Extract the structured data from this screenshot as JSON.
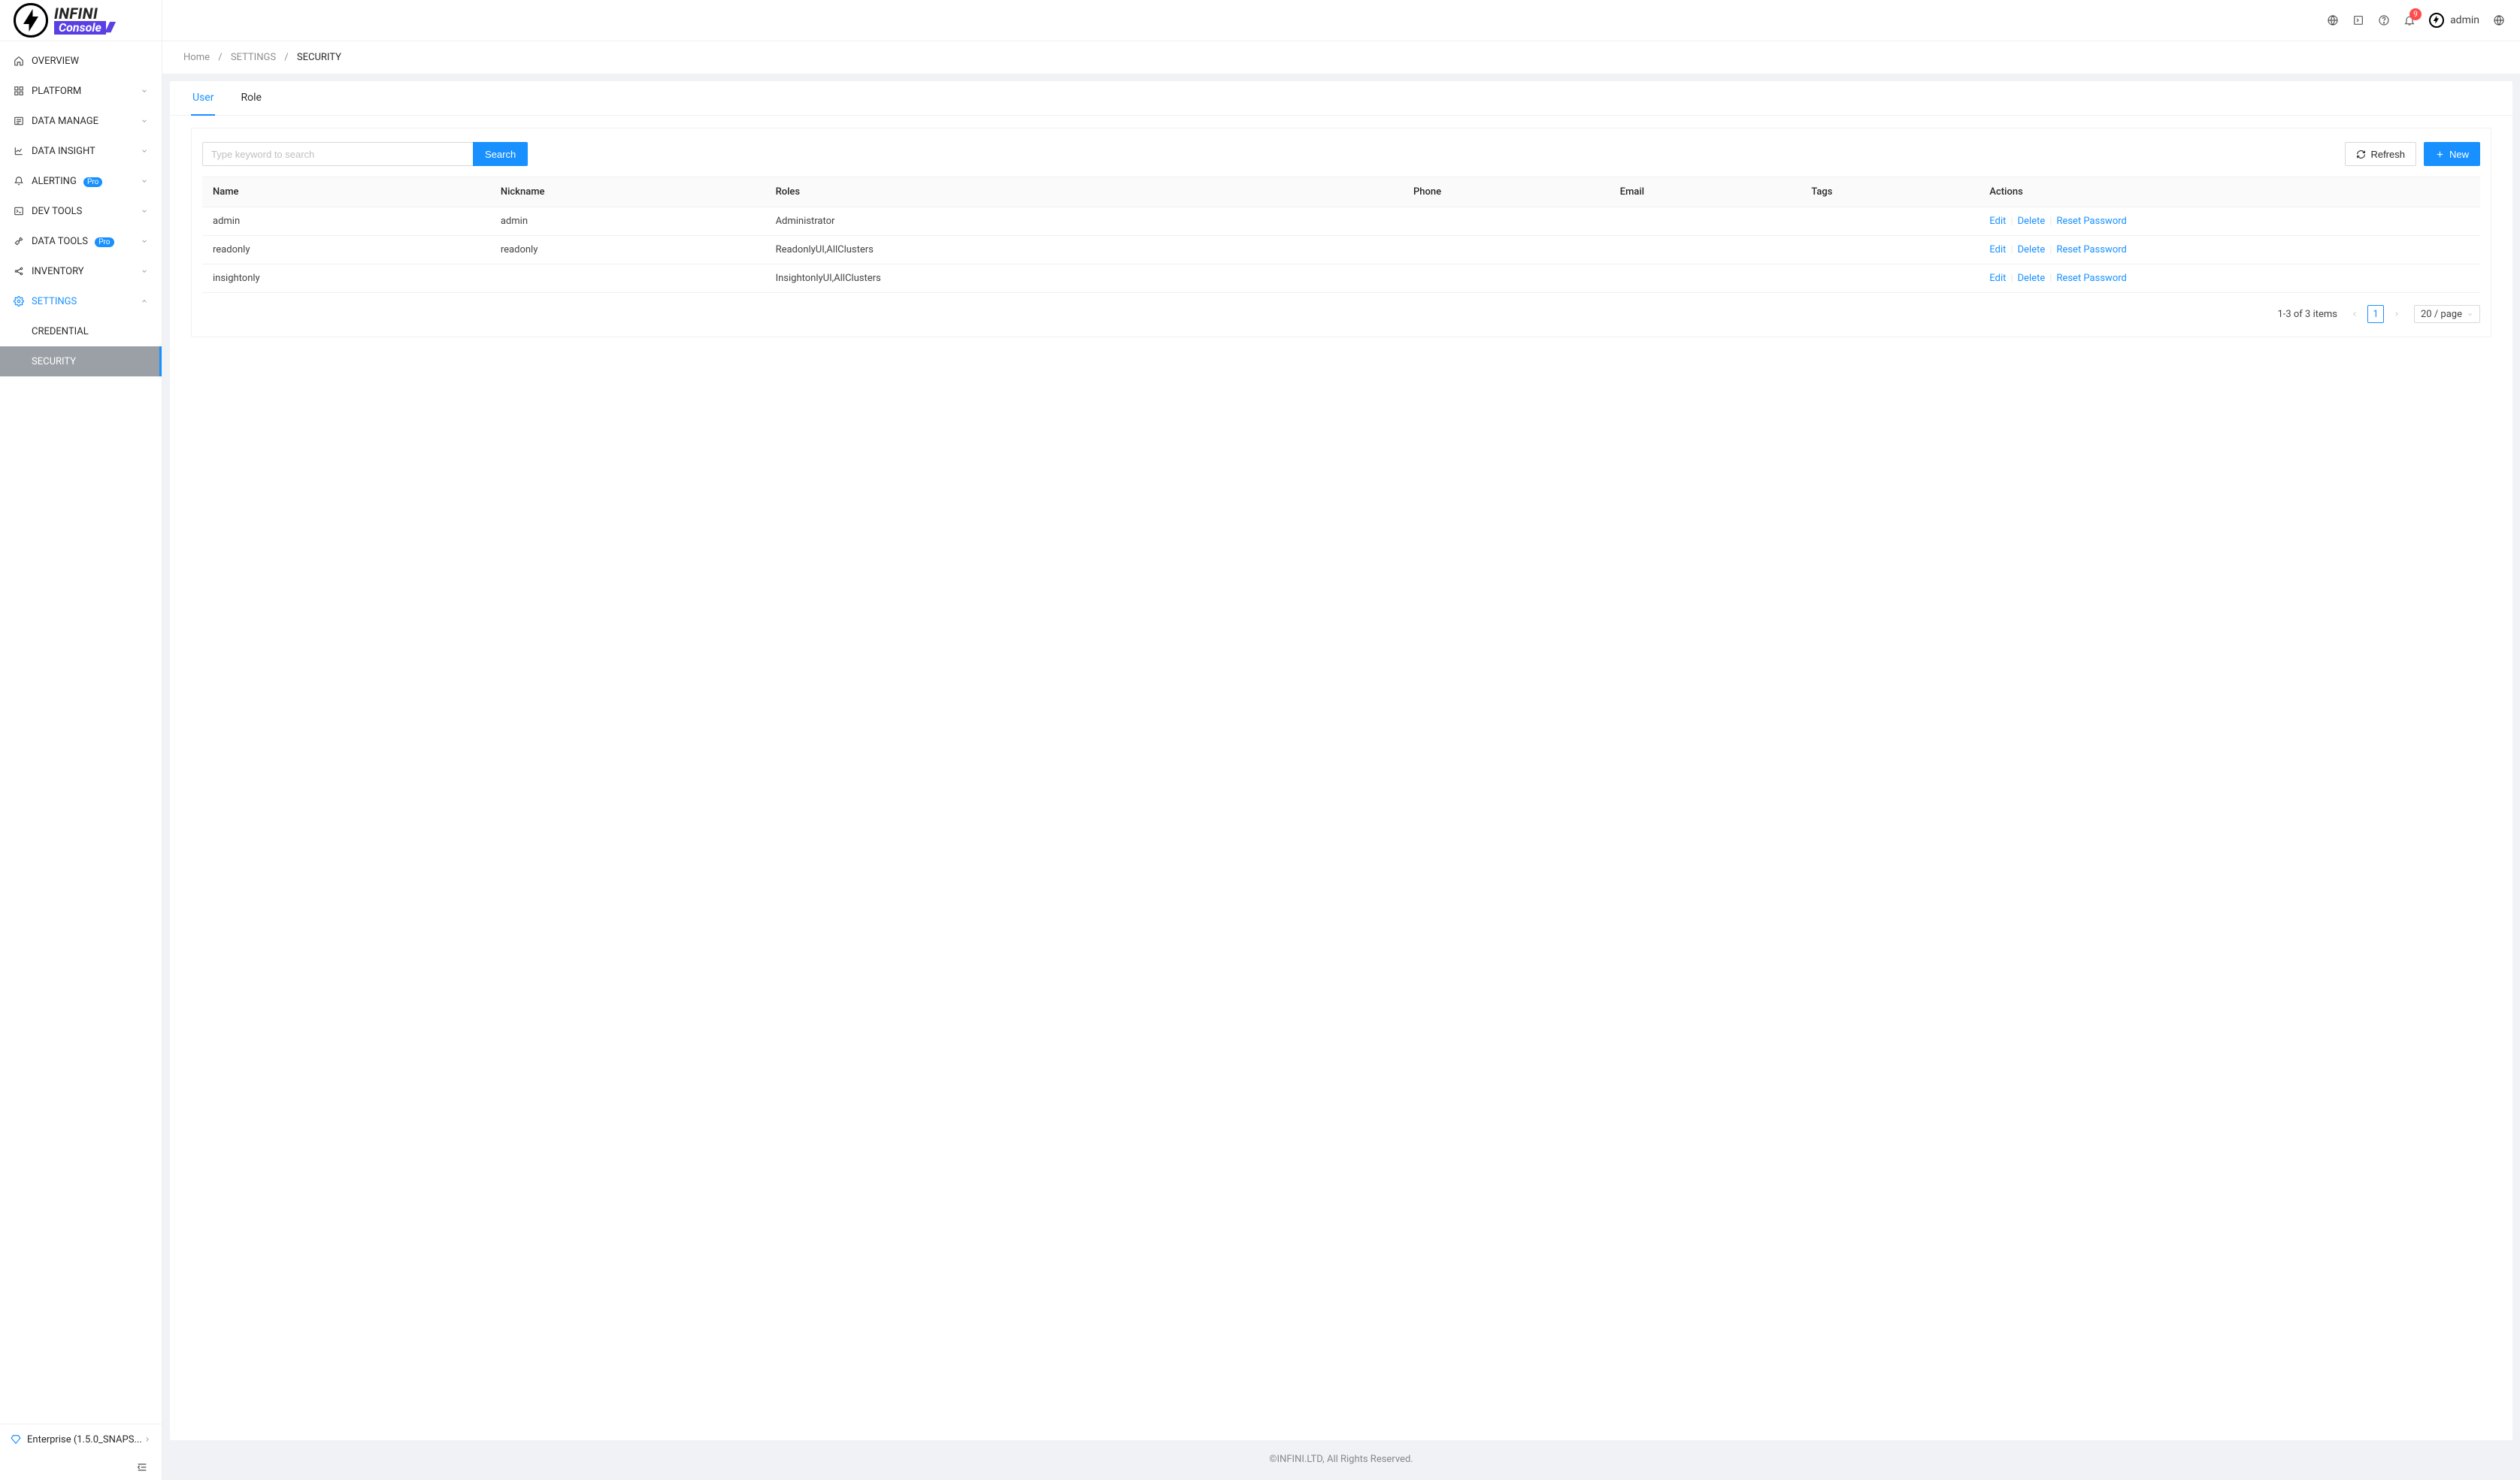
{
  "brand": {
    "line1": "INFINI",
    "line2": "Console",
    "slashes": "////"
  },
  "topbar": {
    "notification_count": "9",
    "username": "admin"
  },
  "sidebar": {
    "items": [
      {
        "label": "OVERVIEW",
        "icon": "home",
        "expandable": false
      },
      {
        "label": "PLATFORM",
        "icon": "platform",
        "expandable": true
      },
      {
        "label": "DATA MANAGE",
        "icon": "data-manage",
        "expandable": true
      },
      {
        "label": "DATA INSIGHT",
        "icon": "chart",
        "expandable": true
      },
      {
        "label": "ALERTING",
        "icon": "bell",
        "expandable": true,
        "pro": true
      },
      {
        "label": "DEV TOOLS",
        "icon": "terminal",
        "expandable": true
      },
      {
        "label": "DATA TOOLS",
        "icon": "tool",
        "expandable": true,
        "pro": true
      },
      {
        "label": "INVENTORY",
        "icon": "share",
        "expandable": true
      },
      {
        "label": "SETTINGS",
        "icon": "gear",
        "expandable": true,
        "active": true,
        "open": true,
        "children": [
          {
            "label": "CREDENTIAL"
          },
          {
            "label": "SECURITY",
            "selected": true
          }
        ]
      }
    ],
    "pro_badge": "Pro",
    "version": "Enterprise (1.5.0_SNAPS..."
  },
  "breadcrumb": {
    "items": [
      "Home",
      "SETTINGS",
      "SECURITY"
    ]
  },
  "tabs": {
    "items": [
      {
        "label": "User",
        "active": true
      },
      {
        "label": "Role",
        "active": false
      }
    ]
  },
  "toolbar": {
    "search_placeholder": "Type keyword to search",
    "search_button": "Search",
    "refresh_button": "Refresh",
    "new_button": "New"
  },
  "table": {
    "columns": [
      "Name",
      "Nickname",
      "Roles",
      "Phone",
      "Email",
      "Tags",
      "Actions"
    ],
    "actions": {
      "edit": "Edit",
      "delete": "Delete",
      "reset": "Reset Password"
    },
    "rows": [
      {
        "name": "admin",
        "nickname": "admin",
        "roles": "Administrator",
        "phone": "",
        "email": "",
        "tags": ""
      },
      {
        "name": "readonly",
        "nickname": "readonly",
        "roles": "ReadonlyUI,AllClusters",
        "phone": "",
        "email": "",
        "tags": ""
      },
      {
        "name": "insightonly",
        "nickname": "",
        "roles": "InsightonlyUI,AllClusters",
        "phone": "",
        "email": "",
        "tags": ""
      }
    ]
  },
  "pagination": {
    "summary": "1-3 of 3 items",
    "current_page": "1",
    "page_size_label": "20 / page"
  },
  "footer": "©INFINI.LTD, All Rights Reserved."
}
